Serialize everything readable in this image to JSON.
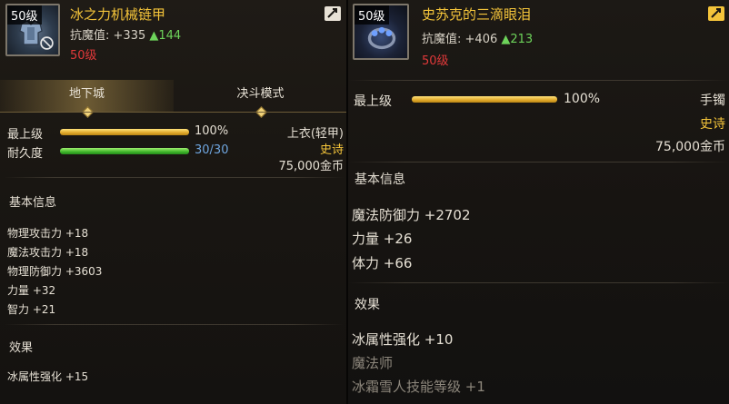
{
  "left": {
    "icon": {
      "level_tag": "50级"
    },
    "name": "冰之力机械链甲",
    "resist": {
      "label": "抗魔值:",
      "value": "+335",
      "delta": "▲144"
    },
    "req_level": "50级",
    "tabs": [
      {
        "label": "地下城",
        "active": true
      },
      {
        "label": "决斗模式",
        "active": false
      }
    ],
    "bars": [
      {
        "label": "最上级",
        "value_text": "100%",
        "fill": 1.0,
        "color": "gold"
      },
      {
        "label": "耐久度",
        "value_text": "30/30",
        "fill": 1.0,
        "color": "green"
      }
    ],
    "type": "上衣(轻甲)",
    "rarity": "史诗",
    "price": "75,000金币",
    "basic_title": "基本信息",
    "attributes": [
      "物理攻击力 +18",
      "魔法攻击力 +18",
      "物理防御力 +3603",
      "力量 +32",
      "智力 +21"
    ],
    "effects_title": "效果",
    "effects": [
      "冰属性强化 +15"
    ]
  },
  "right": {
    "icon": {
      "level_tag": "50级"
    },
    "name": "史苏克的三滴眼泪",
    "resist": {
      "label": "抗魔值:",
      "value": "+406",
      "delta": "▲213"
    },
    "req_level": "50级",
    "bars": [
      {
        "label": "最上级",
        "value_text": "100%",
        "fill": 1.0,
        "color": "gold"
      }
    ],
    "type": "手镯",
    "rarity": "史诗",
    "price": "75,000金币",
    "basic_title": "基本信息",
    "attributes": [
      "魔法防御力 +2702",
      "力量 +26",
      "体力 +66"
    ],
    "effects_title": "效果",
    "effects": [
      "冰属性强化 +10",
      "魔法师",
      "冰霜雪人技能等级 +1"
    ]
  },
  "colors": {
    "epic": "#f4c43a",
    "req_level": "#e0393a",
    "up_arrow": "#6dd35a",
    "durability": "#6fa6e0"
  },
  "icons": [
    "no-equip-icon",
    "compare-icon",
    "tab-diamond-icon"
  ]
}
